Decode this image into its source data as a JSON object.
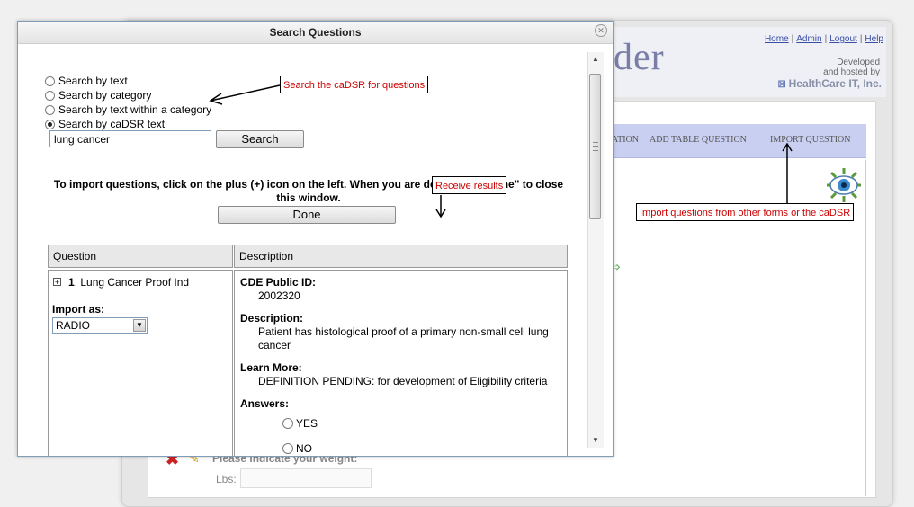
{
  "background": {
    "logo_fragment": "der",
    "top_links": [
      "Home",
      "Admin",
      "Logout",
      "Help"
    ],
    "hosted_line1": "Developed",
    "hosted_line2": "and hosted by",
    "brand": "HealthCare IT, Inc.",
    "nav_items": [
      "ATION",
      "ADD TABLE QUESTION",
      "IMPORT QUESTION"
    ],
    "question_text": "Please indicate your weight:",
    "lbs_label": "Lbs:"
  },
  "dialog": {
    "title": "Search Questions",
    "radios": [
      {
        "label": "Search by text",
        "selected": false
      },
      {
        "label": "Search by category",
        "selected": false
      },
      {
        "label": "Search by text within a category",
        "selected": false
      },
      {
        "label": "Search by caDSR text",
        "selected": true
      }
    ],
    "search_value": "lung cancer",
    "search_button": "Search",
    "instructions": "To import questions, click on the plus (+) icon on the left. When you are done, click \"Done\" to close this window.",
    "done_button": "Done",
    "table": {
      "headers": [
        "Question",
        "Description"
      ],
      "question_number": "1",
      "question_label": "Lung Cancer Proof Ind",
      "import_as_label": "Import as:",
      "import_as_value": "RADIO",
      "cde_id_label": "CDE Public ID:",
      "cde_id_value": "2002320",
      "description_label": "Description:",
      "description_value": "Patient has histological proof of a primary non-small cell lung cancer",
      "learn_more_label": "Learn More:",
      "learn_more_value": "DEFINITION PENDING: for development of Eligibility criteria",
      "answers_label": "Answers:",
      "answers": [
        "YES",
        "NO"
      ]
    }
  },
  "callouts": {
    "search_caDSR": "Search the caDSR for questions",
    "receive_results": "Receive results",
    "import_questions": "Import questions from other forms or the caDSR"
  },
  "colors": {
    "callout_text": "#cc0000",
    "nav_bg": "#c9cff1"
  }
}
